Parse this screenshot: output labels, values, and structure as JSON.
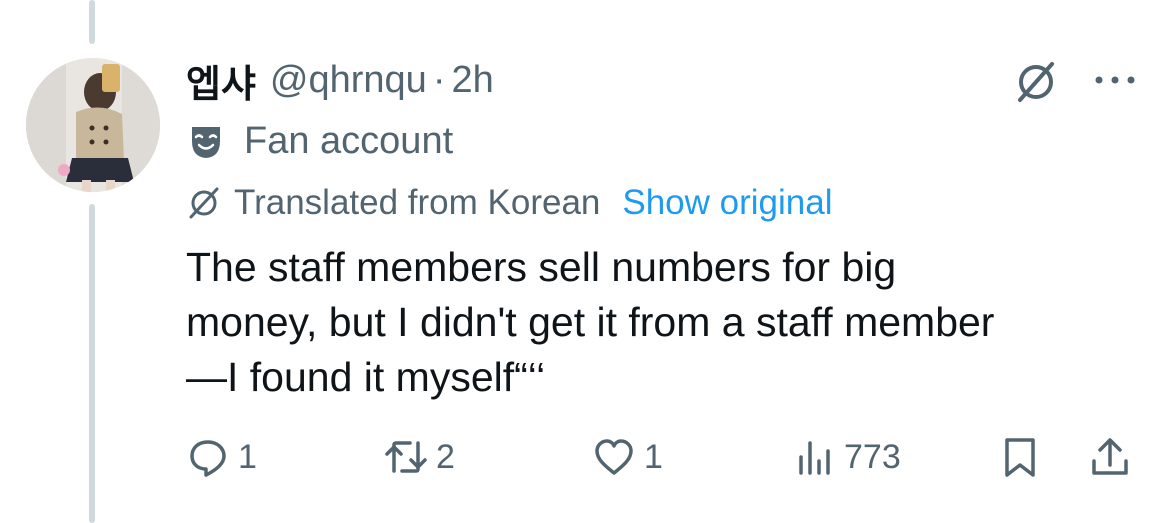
{
  "tweet": {
    "author": {
      "display_name": "엡샤",
      "handle": "@qhrnqu"
    },
    "separator": "·",
    "time": "2h",
    "label": "Fan account",
    "translation": {
      "note": "Translated from Korean",
      "show_original": "Show original"
    },
    "text": "The staff members sell numbers for big\nmoney, but I didn't get it from a staff member\n—I found it myself“‘‘"
  },
  "actions": {
    "replies": "1",
    "reposts": "2",
    "likes": "1",
    "views": "773"
  },
  "icons": {
    "translate": "translate-icon",
    "more": "more-icon",
    "label": "theater-masks-icon",
    "reply": "reply-icon",
    "repost": "repost-icon",
    "like": "heart-icon",
    "views": "analytics-icon",
    "bookmark": "bookmark-icon",
    "share": "share-icon"
  },
  "colors": {
    "text": "#0f1419",
    "secondary": "#536471",
    "link": "#1d9bf0",
    "thread_line": "#cfd9de"
  }
}
